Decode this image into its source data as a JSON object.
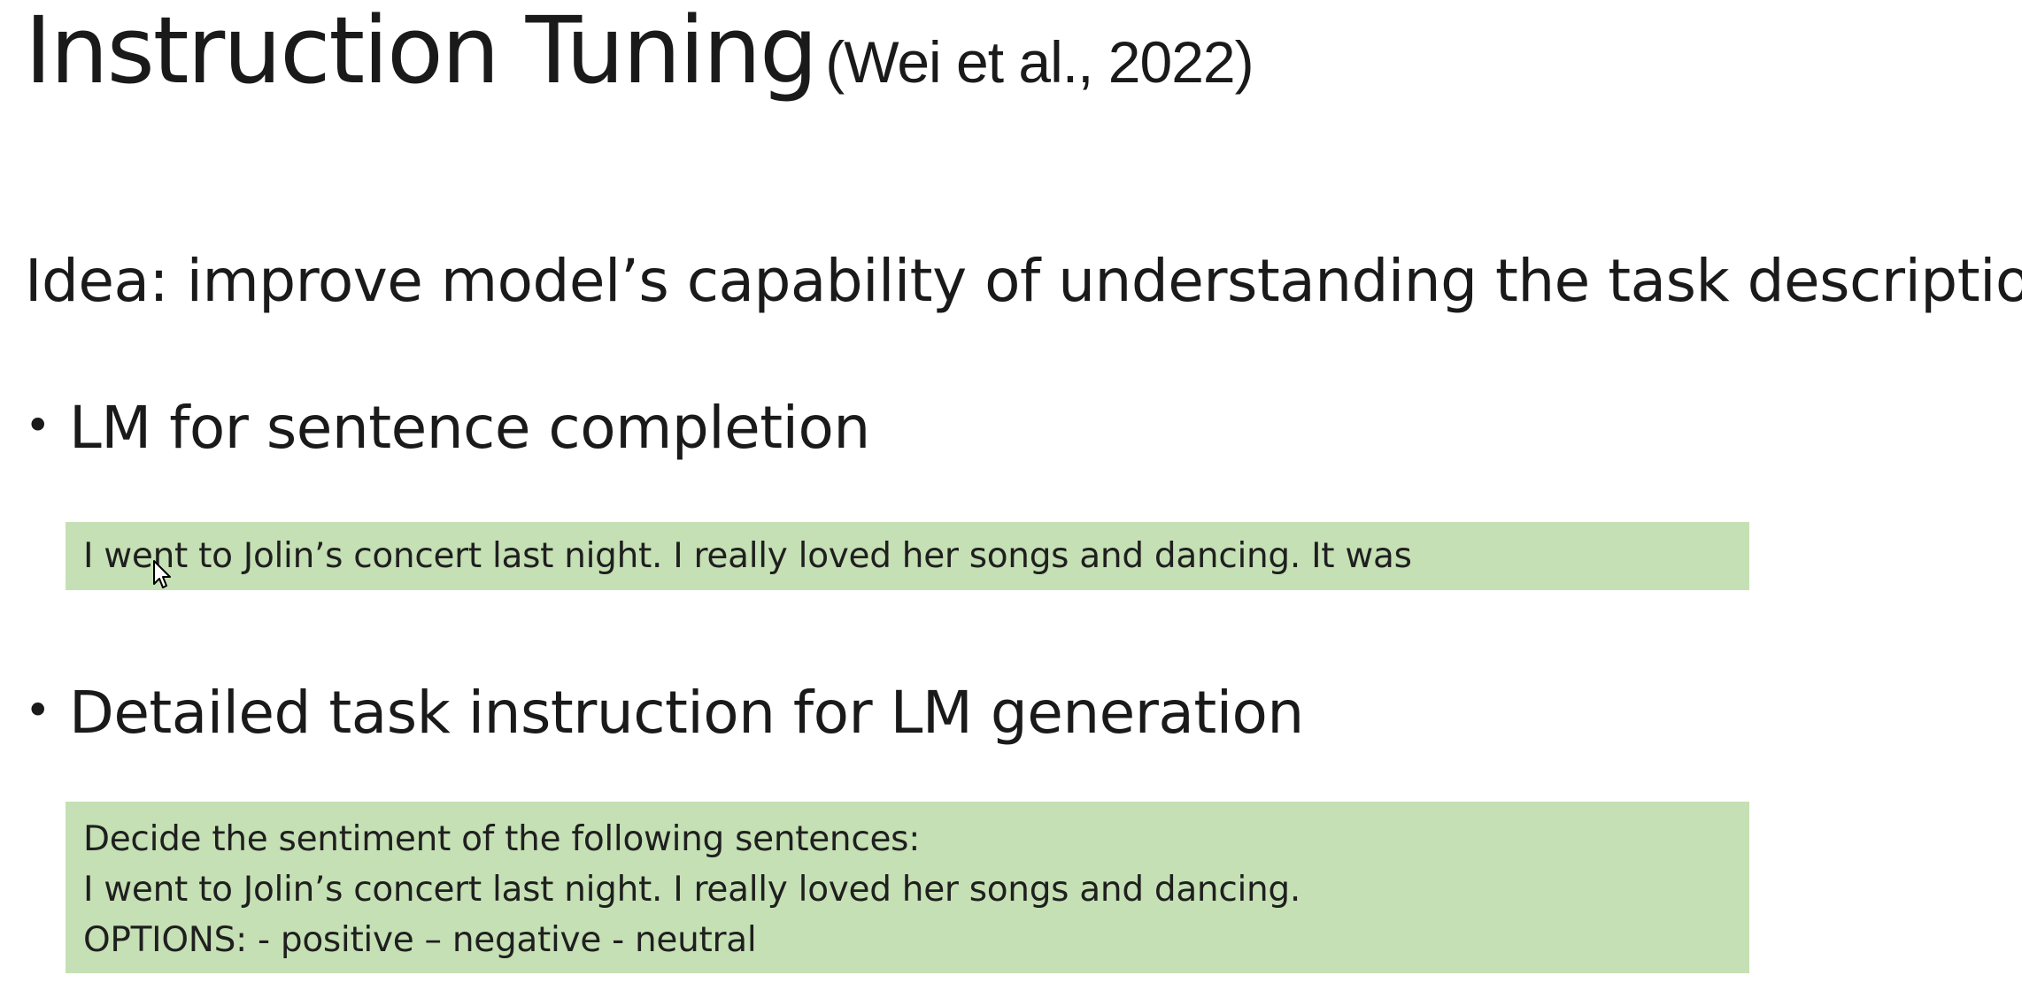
{
  "slide": {
    "title": "Instruction Tuning",
    "citation": "(Wei et al., 2022)",
    "idea": "Idea: improve model’s capability of understanding the task description",
    "bullets": [
      {
        "label": "LM for sentence completion",
        "example_lines": [
          "I went to Jolin’s concert last night. I really loved her songs and dancing. It was"
        ]
      },
      {
        "label": "Detailed task instruction for LM generation",
        "example_lines": [
          "Decide the sentiment of the following sentences:",
          "I went to Jolin’s concert last night. I really loved her songs and dancing.",
          "OPTIONS: - positive – negative - neutral"
        ]
      }
    ],
    "bullet_glyph": "•",
    "colors": {
      "background": "#ffffff",
      "text": "#1a1a1a",
      "example_box": "#c5e0b4"
    },
    "icons": {
      "cursor": "mouse-pointer-icon"
    }
  }
}
